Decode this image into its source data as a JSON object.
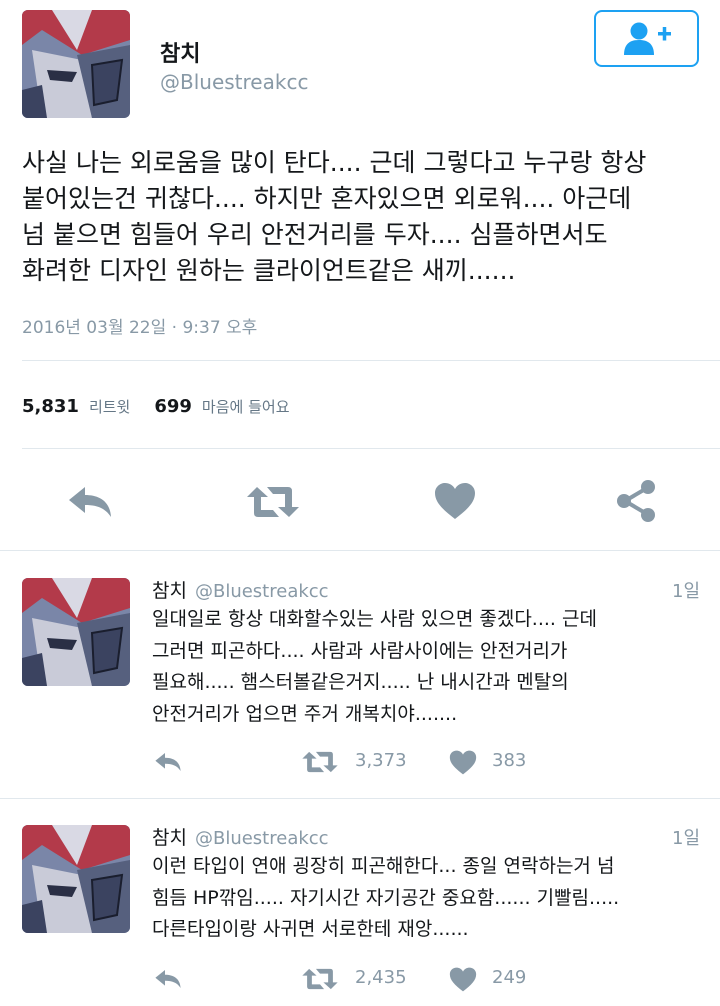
{
  "main_tweet": {
    "user_name": "참치",
    "handle": "@Bluestreakcc",
    "text_lines": [
      "사실 나는 외로움을 많이 탄다.... 근데 그렇다고 누구랑 항상",
      "붙어있는건 귀찮다.... 하지만 혼자있으면 외로워.... 아근데",
      "넘 붙으면 힘들어 우리 안전거리를 두자.... 심플하면서도",
      "화려한 디자인 원하는 클라이언트같은 새끼......"
    ],
    "timestamp": "2016년 03월 22일 · 9:37 오후",
    "retweet_count": "5,831",
    "retweet_label": "리트윗",
    "like_count": "699",
    "like_label": "마음에 들어요"
  },
  "follow_button": {
    "icon": "add-user-icon",
    "color": "#1da1f2"
  },
  "actions": {
    "icons": [
      "reply-icon",
      "retweet-icon",
      "heart-icon",
      "share-icon"
    ],
    "color": "#8899a6"
  },
  "replies": [
    {
      "user_name": "참치",
      "handle": "@Bluestreakcc",
      "time": "1일",
      "text_lines": [
        "일대일로 항상 대화할수있는 사람 있으면 좋겠다.... 근데",
        "그러면 피곤하다.... 사람과 사람사이에는 안전거리가",
        "필요해..... 햄스터볼같은거지..... 난 내시간과 멘탈의",
        "안전거리가 업으면 주거 개복치야......."
      ],
      "retweets": "3,373",
      "likes": "383"
    },
    {
      "user_name": "참치",
      "handle": "@Bluestreakcc",
      "time": "1일",
      "text_lines": [
        "이런 타입이 연애 굉장히 피곤해한다... 종일 연락하는거 넘",
        "힘듬 HP깎임..... 자기시간 자기공간 중요함...... 기빨림.....",
        "다른타입이랑 사귀면 서로한테 재앙......"
      ],
      "retweets": "2,435",
      "likes": "249"
    }
  ]
}
